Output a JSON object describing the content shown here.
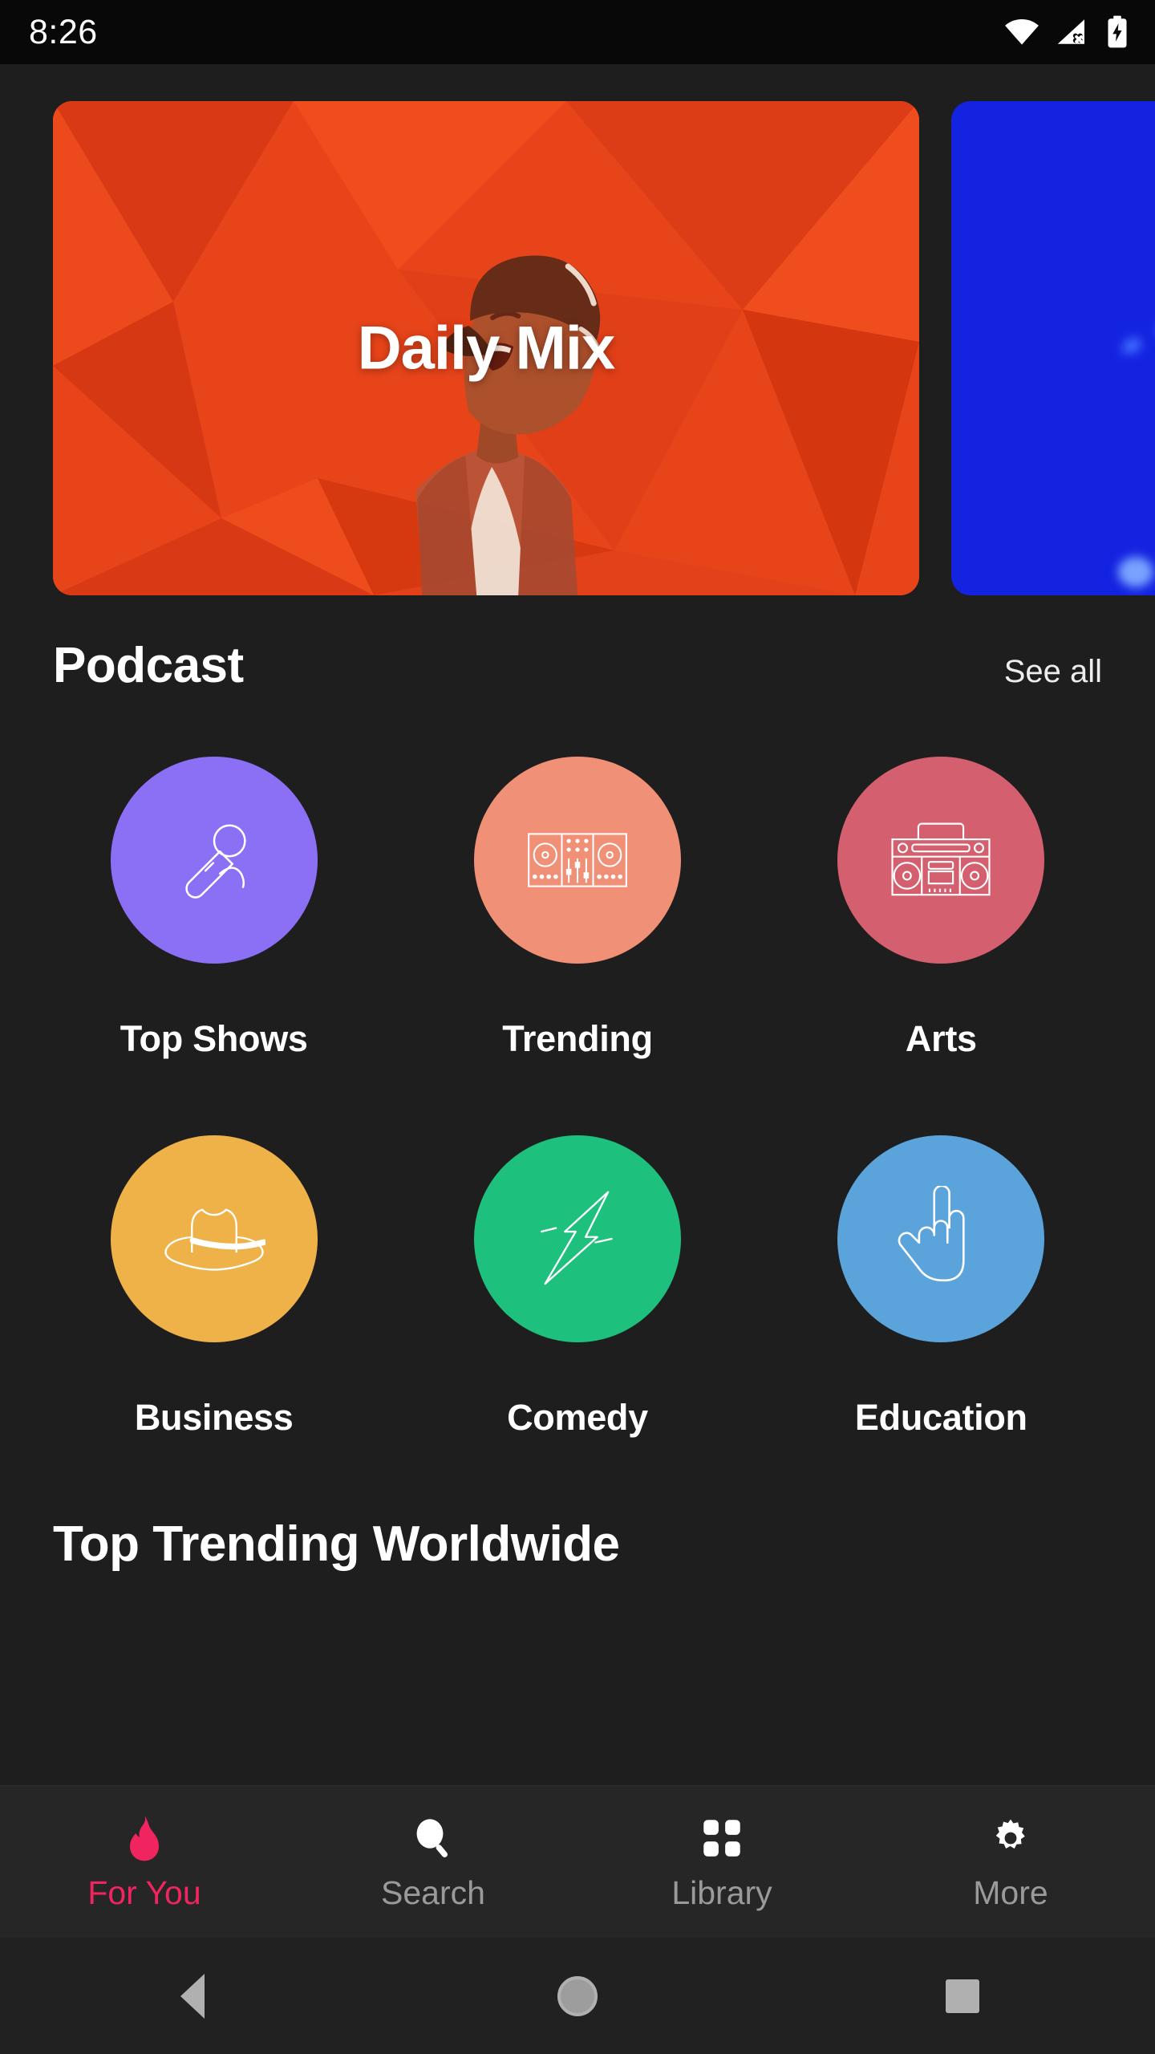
{
  "status_bar": {
    "time": "8:26",
    "icons": [
      "wifi-icon",
      "cellular-off-icon",
      "battery-charging-icon"
    ]
  },
  "carousel": {
    "cards": [
      {
        "title": "Daily Mix",
        "bg_color": "#e8441a",
        "art": "man-in-cap-low-poly"
      },
      {
        "title": "",
        "bg_color": "#1423e0",
        "art": "blue-concert-lights"
      }
    ]
  },
  "podcast_section": {
    "title": "Podcast",
    "see_all_label": "See all",
    "categories": [
      {
        "label": "Top Shows",
        "color": "#8b6ff5",
        "icon": "microphone-icon"
      },
      {
        "label": "Trending",
        "color": "#f09077",
        "icon": "dj-mixer-icon"
      },
      {
        "label": "Arts",
        "color": "#d45f6e",
        "icon": "boombox-icon"
      },
      {
        "label": "Business",
        "color": "#efb249",
        "icon": "cowboy-hat-icon"
      },
      {
        "label": "Comedy",
        "color": "#1ec07d",
        "icon": "lightning-bolt-icon"
      },
      {
        "label": "Education",
        "color": "#5ba3db",
        "icon": "rock-hand-icon"
      }
    ]
  },
  "next_section": {
    "title": "Top Trending Worldwide"
  },
  "tab_bar": {
    "active_color": "#f0245e",
    "inactive_color": "#9a9a9a",
    "tabs": [
      {
        "label": "For You",
        "icon": "flame-icon",
        "active": true
      },
      {
        "label": "Search",
        "icon": "search-icon",
        "active": false
      },
      {
        "label": "Library",
        "icon": "grid-icon",
        "active": false
      },
      {
        "label": "More",
        "icon": "gear-icon",
        "active": false
      }
    ]
  },
  "nav_bar": {
    "buttons": [
      {
        "name": "back",
        "icon": "triangle-left-icon"
      },
      {
        "name": "home",
        "icon": "circle-icon"
      },
      {
        "name": "recents",
        "icon": "square-icon"
      }
    ]
  }
}
